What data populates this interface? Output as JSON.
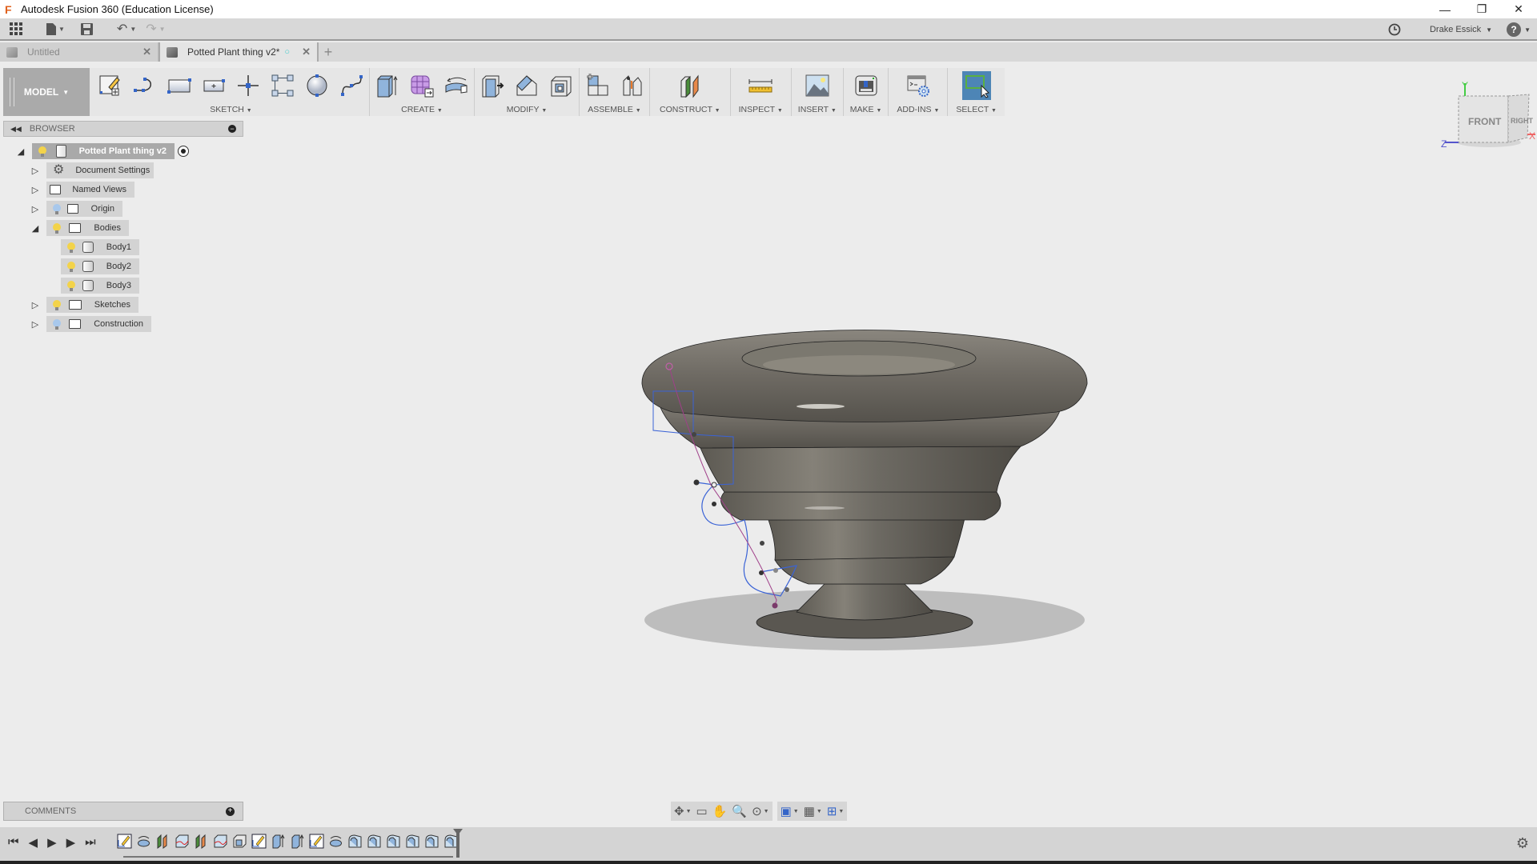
{
  "window": {
    "app_title": "Autodesk Fusion 360 (Education License)",
    "app_logo": "F",
    "controls": {
      "minimize": "—",
      "restore": "❐",
      "close": "✕"
    }
  },
  "quick_access": {
    "apps_icon": "grid-icon",
    "file_icon": "file-icon",
    "save_icon": "save-icon",
    "undo_icon": "undo-icon",
    "redo_icon": "redo-icon",
    "job_status_icon": "clock-icon",
    "user_name": "Drake Essick",
    "help_label": "?"
  },
  "tabs": [
    {
      "label": "Untitled",
      "active": false
    },
    {
      "label": "Potted Plant thing v2*",
      "active": true,
      "saved_indicator": "○"
    }
  ],
  "toolbar": {
    "workspace": "MODEL",
    "groups": [
      {
        "label": "SKETCH",
        "tools": [
          "create-sketch",
          "arc",
          "rectangle-2pt",
          "rectangle-center",
          "point",
          "rectangular-pattern",
          "circle",
          "spline"
        ]
      },
      {
        "label": "CREATE",
        "tools": [
          "extrude",
          "create-form",
          "revolve"
        ]
      },
      {
        "label": "MODIFY",
        "tools": [
          "press-pull",
          "chamfer",
          "shell"
        ]
      },
      {
        "label": "ASSEMBLE",
        "tools": [
          "new-component",
          "joint"
        ]
      },
      {
        "label": "CONSTRUCT",
        "tools": [
          "offset-plane"
        ]
      },
      {
        "label": "INSPECT",
        "tools": [
          "measure"
        ]
      },
      {
        "label": "INSERT",
        "tools": [
          "insert-image"
        ]
      },
      {
        "label": "MAKE",
        "tools": [
          "3d-print"
        ]
      },
      {
        "label": "ADD-INS",
        "tools": [
          "scripts"
        ]
      },
      {
        "label": "SELECT",
        "tools": [
          "select"
        ]
      }
    ]
  },
  "browser": {
    "title": "BROWSER",
    "root": "Potted Plant thing v2",
    "items": [
      {
        "label": "Document Settings",
        "icon": "gear-icon",
        "level": 1,
        "expanded": false
      },
      {
        "label": "Named Views",
        "icon": "folder-icon",
        "level": 1,
        "expanded": false
      },
      {
        "label": "Origin",
        "icon": "folder-icon",
        "level": 1,
        "expanded": false,
        "visible": false
      },
      {
        "label": "Bodies",
        "icon": "folder-icon",
        "level": 1,
        "expanded": true,
        "visible": true
      },
      {
        "label": "Body1",
        "icon": "body-icon",
        "level": 2,
        "visible": true
      },
      {
        "label": "Body2",
        "icon": "body-icon",
        "level": 2,
        "visible": true
      },
      {
        "label": "Body3",
        "icon": "body-icon",
        "level": 2,
        "visible": true
      },
      {
        "label": "Sketches",
        "icon": "folder-icon",
        "level": 1,
        "expanded": false,
        "visible": true
      },
      {
        "label": "Construction",
        "icon": "folder-icon",
        "level": 1,
        "expanded": false,
        "visible": false
      }
    ]
  },
  "viewcube": {
    "front": "FRONT",
    "right": "RIGHT",
    "axis_x": "X",
    "axis_y": "Y",
    "axis_z": "Z"
  },
  "comments": {
    "title": "COMMENTS"
  },
  "nav_tools": [
    "orbit",
    "look-at",
    "pan",
    "zoom",
    "fit",
    "display-settings",
    "grid-snaps",
    "viewports"
  ],
  "timeline": {
    "controls": [
      "first",
      "previous",
      "play",
      "next",
      "last"
    ],
    "features": [
      "sketch",
      "revolve",
      "plane",
      "split",
      "plane",
      "split",
      "shell",
      "sketch",
      "extrude",
      "extrude",
      "sketch",
      "revolve",
      "fillet",
      "fillet",
      "fillet",
      "fillet",
      "fillet",
      "fillet"
    ]
  },
  "colors": {
    "selected_tool": "#4d85b6",
    "model_surface": "#6f6b64",
    "sketch_line": "#3a63d6",
    "spline_path": "#a0408a"
  }
}
